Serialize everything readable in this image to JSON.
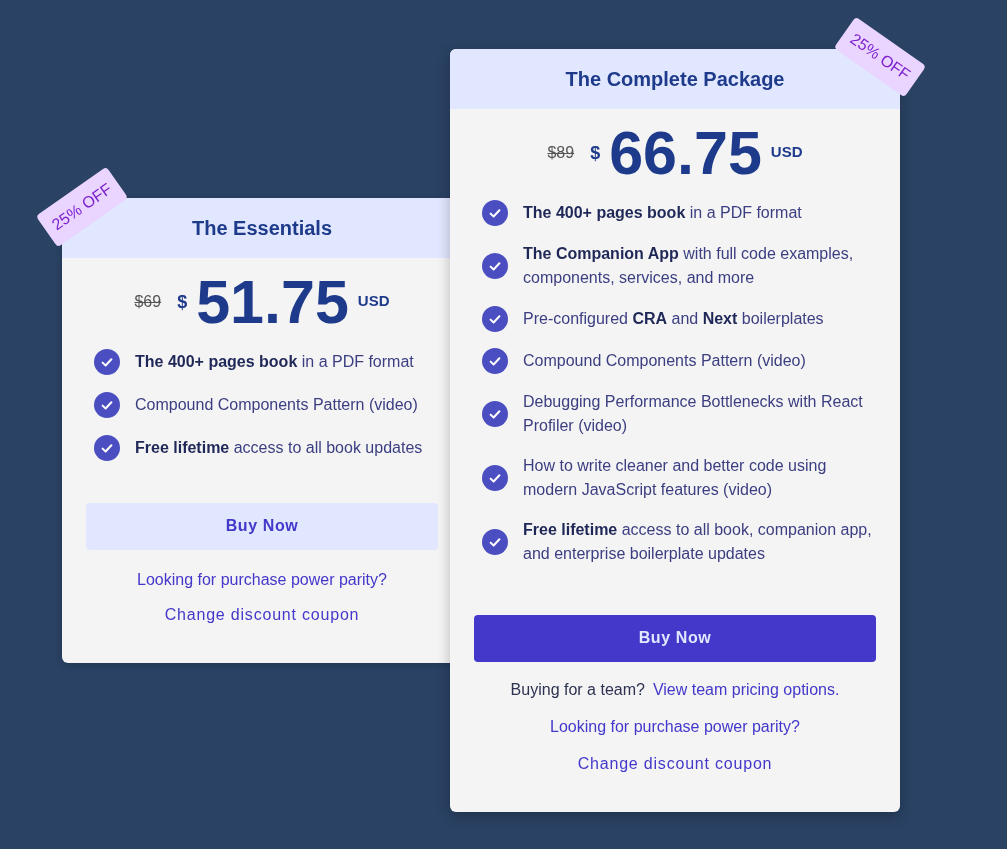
{
  "plans": [
    {
      "title": "The Essentials",
      "badge": "25% OFF",
      "featured": false,
      "original_price": "$69",
      "currency_symbol": "$",
      "price": "51.75",
      "currency": "USD",
      "features": [
        "**The 400+ pages book** in a PDF format",
        "Compound Components Pattern (video)",
        "**Free lifetime** access to all book updates"
      ],
      "buy_button": "Buy Now",
      "links": [
        "Looking for purchase power parity?",
        "Change discount coupon"
      ]
    },
    {
      "title": "The Complete Package",
      "badge": "25% OFF",
      "featured": true,
      "original_price": "$89",
      "currency_symbol": "$",
      "price": "66.75",
      "currency": "USD",
      "features": [
        "**The 400+ pages book** in a PDF format",
        "**The Companion App** with full code examples, components, services, and more",
        "Pre-configured **CRA** and **Next** boilerplates",
        "Compound Components Pattern (video)",
        "Debugging Performance Bottlenecks with React Profiler (video)",
        "How to write cleaner and better code using modern JavaScript features (video)",
        "**Free lifetime** access to all book, companion app, and enterprise boilerplate updates"
      ],
      "buy_button": "Buy Now",
      "team_prompt": {
        "text": "Buying for a team?",
        "link": "View team pricing options."
      },
      "links": [
        "Looking for purchase power parity?",
        "Change discount coupon"
      ]
    }
  ]
}
